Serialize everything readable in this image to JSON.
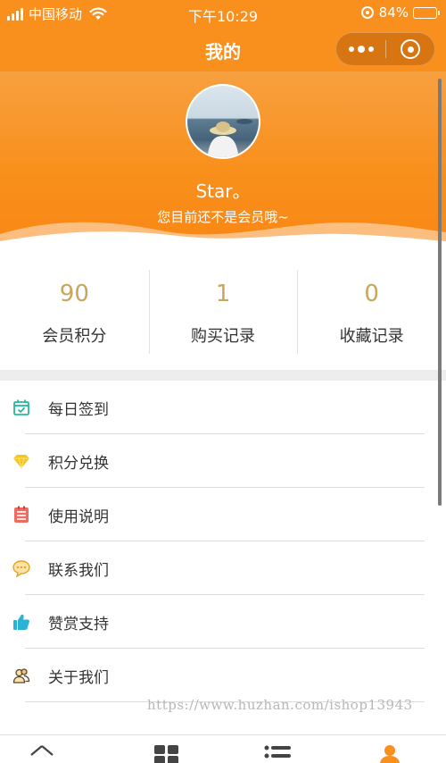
{
  "status_bar": {
    "carrier": "中国移动",
    "time": "下午10:29",
    "battery": "84%",
    "battery_level": 0.84
  },
  "nav": {
    "title": "我的"
  },
  "profile": {
    "username": "Star。",
    "member_note": "您目前还不是会员哦~"
  },
  "stats": [
    {
      "value": "90",
      "label": "会员积分"
    },
    {
      "value": "1",
      "label": "购买记录"
    },
    {
      "value": "0",
      "label": "收藏记录"
    }
  ],
  "menu": [
    {
      "label": "每日签到",
      "icon": "calendar-check-icon",
      "color": "#25b99a"
    },
    {
      "label": "积分兑换",
      "icon": "diamond-icon",
      "color": "#f5c61b"
    },
    {
      "label": "使用说明",
      "icon": "notepad-icon",
      "color": "#ee6b5f"
    },
    {
      "label": "联系我们",
      "icon": "chat-bubble-icon",
      "color": "#e6a321"
    },
    {
      "label": "赞赏支持",
      "icon": "thumbs-up-icon",
      "color": "#2ab3d6"
    },
    {
      "label": "关于我们",
      "icon": "users-icon",
      "color": "#d98c1a"
    }
  ],
  "watermark": "https://www.huzhan.com/ishop13943",
  "tab_bar": {
    "tabs": [
      {
        "icon": "home-icon"
      },
      {
        "icon": "grid-icon"
      },
      {
        "icon": "list-icon"
      },
      {
        "icon": "profile-icon",
        "active": true
      }
    ]
  },
  "colors": {
    "brand": "#f98f1c",
    "stat_value": "#c8a65e"
  }
}
